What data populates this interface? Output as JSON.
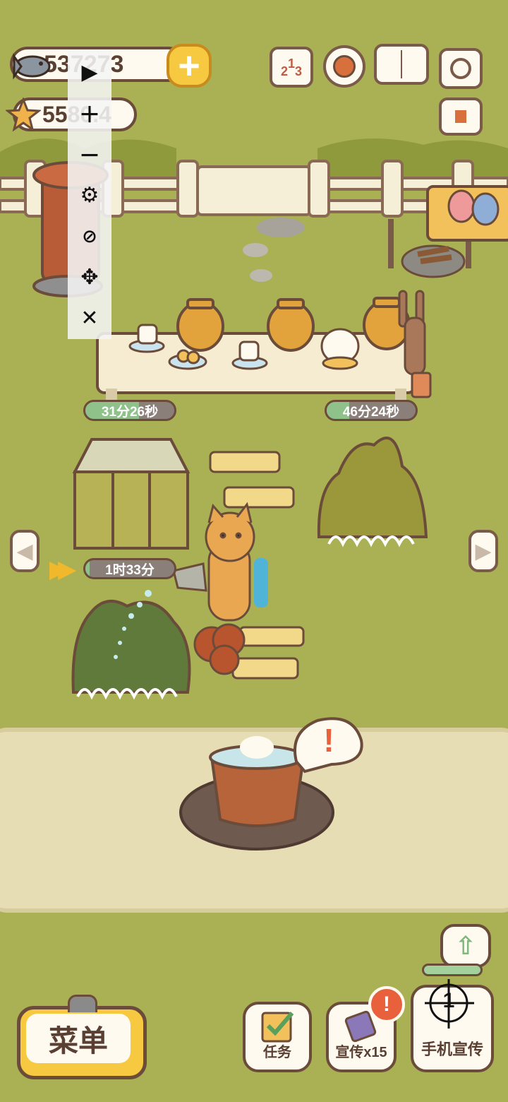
{
  "currency": {
    "fish": "537273",
    "stars": "5580.4"
  },
  "timers": {
    "table_left": "31分26秒",
    "table_right": "46分24秒",
    "greenhouse": "1时33分"
  },
  "timer_progress": {
    "table_left": 0.6,
    "table_right": 0.25,
    "greenhouse": 0.05
  },
  "top_icons": [
    "podium-icon",
    "gear-icon",
    "book-icon",
    "camera-icon",
    "newspaper-icon"
  ],
  "podium_digits": [
    "2",
    "1",
    "3"
  ],
  "overlay_toolbar": {
    "items": [
      "play-icon",
      "zoom-in-icon",
      "zoom-out-icon",
      "gear-icon",
      "hide-icon",
      "move-icon",
      "close-icon"
    ]
  },
  "bottom": {
    "menu_label": "菜单",
    "tasks_label": "任务",
    "promo_label": "宣传x15",
    "phone_promo_label": "手机宣传",
    "phone_badge": "1",
    "alert_badge": "!"
  },
  "speech_bubble": "!",
  "colors": {
    "grass": "#a9b154",
    "path": "#e6ddb4",
    "outline": "#6b4b3a",
    "accent": "#f7c941",
    "alert": "#e8603c"
  }
}
